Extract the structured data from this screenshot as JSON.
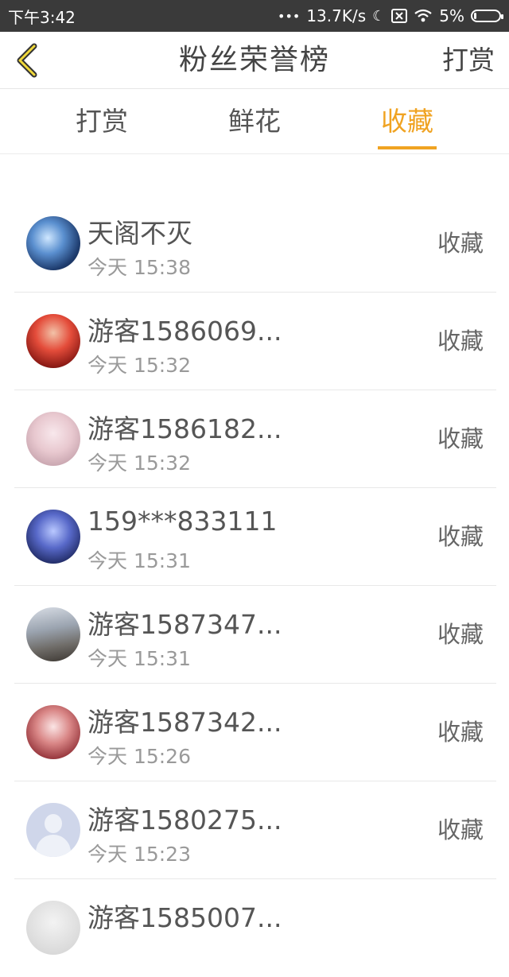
{
  "status_bar": {
    "time": "下午3:42",
    "dots": "•••",
    "speed": "13.7K/s",
    "battery": "5%"
  },
  "navbar": {
    "back_icon": "chevron-left-icon",
    "title": "粉丝荣誉榜",
    "action": "打赏"
  },
  "tabs": [
    {
      "label": "打赏",
      "active": false
    },
    {
      "label": "鲜花",
      "active": false
    },
    {
      "label": "收藏",
      "active": true
    }
  ],
  "accent_color": "#f0a322",
  "list": [
    {
      "name": "天阁不灭",
      "time": "今天 15:38",
      "action": "收藏"
    },
    {
      "name": "游客1586069...",
      "time": "今天 15:32",
      "action": "收藏"
    },
    {
      "name": "游客1586182...",
      "time": "今天 15:32",
      "action": "收藏"
    },
    {
      "name": "159***833111",
      "time": "今天 15:31",
      "action": "收藏"
    },
    {
      "name": "游客1587347...",
      "time": "今天 15:31",
      "action": "收藏"
    },
    {
      "name": "游客1587342...",
      "time": "今天 15:26",
      "action": "收藏"
    },
    {
      "name": "游客1580275...",
      "time": "今天 15:23",
      "action": "收藏"
    },
    {
      "name": "游客1585007...",
      "time": "",
      "action": ""
    }
  ]
}
